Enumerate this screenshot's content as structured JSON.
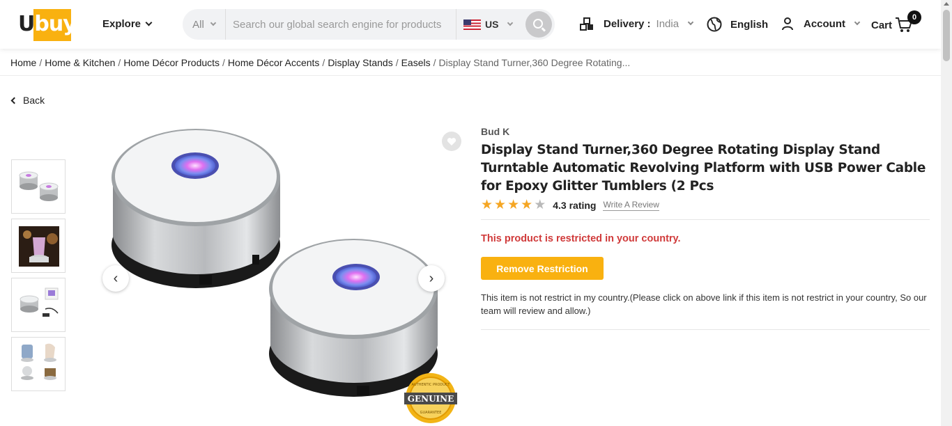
{
  "header": {
    "logo_text": "Ubuy",
    "explore": "Explore",
    "search": {
      "category": "All",
      "placeholder": "Search our global search engine for products",
      "country": "US"
    },
    "delivery_label": "Delivery :",
    "delivery_value": "India",
    "language": "English",
    "account": "Account",
    "cart": "Cart",
    "cart_count": "0"
  },
  "breadcrumb": {
    "items": [
      "Home",
      "Home & Kitchen",
      "Home Décor Products",
      "Home Décor Accents",
      "Display Stands",
      "Easels"
    ],
    "current": "Display Stand Turner,360 Degree Rotating..."
  },
  "back_label": "Back",
  "product": {
    "brand": "Bud K",
    "title": "Display Stand Turner,360 Degree Rotating Display Stand Turntable Automatic Revolving Platform with USB Power Cable for Epoxy Glitter Tumblers  (2 Pcs",
    "rating_value": 4.3,
    "rating_text": "4.3 rating",
    "write_review": "Write A Review",
    "restricted_message": "This product is restricted in your country.",
    "remove_restriction": "Remove Restriction",
    "note": "This item is not restrict in my country.(Please click on above link if this item is not restrict in your country, So our team will review and allow.)",
    "badge_text": "GENUINE",
    "badge_ring_top": "AUTHENTIC PRODUCT",
    "badge_ring_bottom": "GUARANTEE"
  },
  "colors": {
    "accent": "#f9b110",
    "error": "#d03a3a",
    "star": "#f5a623"
  },
  "icons": {
    "heart": "heart-icon",
    "prev": "chevron-left-icon",
    "next": "chevron-right-icon",
    "search": "search-icon",
    "delivery": "boxes-icon",
    "globe": "globe-icon",
    "user": "user-icon",
    "cart": "cart-icon"
  }
}
